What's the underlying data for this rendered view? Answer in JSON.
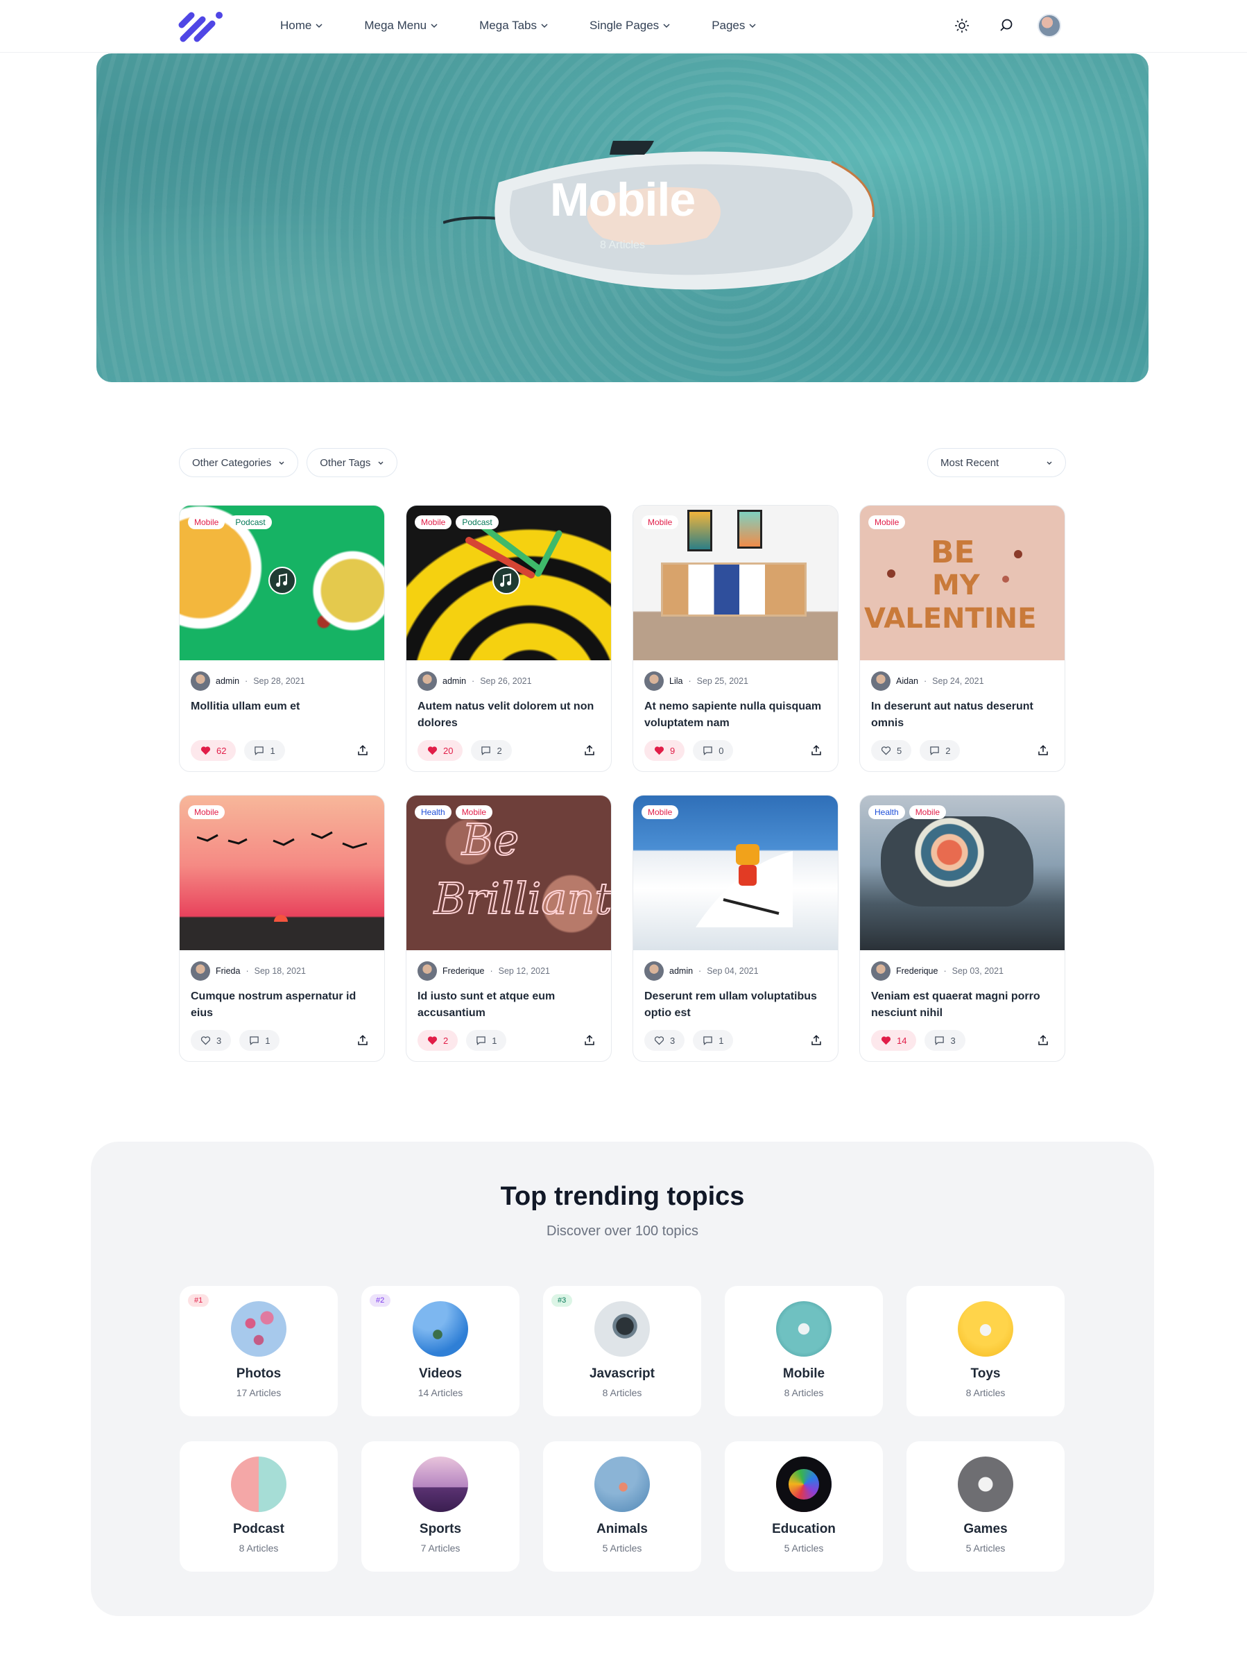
{
  "nav": {
    "items": [
      {
        "label": "Home"
      },
      {
        "label": "Mega Menu"
      },
      {
        "label": "Mega Tabs"
      },
      {
        "label": "Single Pages"
      },
      {
        "label": "Pages"
      }
    ],
    "icons": [
      "sun-icon",
      "search-icon",
      "avatar"
    ]
  },
  "hero": {
    "title": "Mobile",
    "subtitle": "8 Articles"
  },
  "filters": {
    "categories": "Other Categories",
    "tags": "Other Tags",
    "sort": "Most Recent"
  },
  "posts": [
    {
      "tags": [
        "Mobile",
        "Podcast"
      ],
      "author": "admin",
      "date": "Sep 28, 2021",
      "title": "Mollitia ullam eum et",
      "likes": "62",
      "liked": true,
      "comments": "1"
    },
    {
      "tags": [
        "Mobile",
        "Podcast"
      ],
      "author": "admin",
      "date": "Sep 26, 2021",
      "title": "Autem natus velit dolorem ut non dolores",
      "likes": "20",
      "liked": true,
      "comments": "2"
    },
    {
      "tags": [
        "Mobile"
      ],
      "author": "Lila",
      "date": "Sep 25, 2021",
      "title": "At nemo sapiente nulla quisquam voluptatem nam",
      "likes": "9",
      "liked": true,
      "comments": "0"
    },
    {
      "tags": [
        "Mobile"
      ],
      "author": "Aidan",
      "date": "Sep 24, 2021",
      "title": "In deserunt aut natus deserunt omnis",
      "likes": "5",
      "liked": false,
      "comments": "2"
    },
    {
      "tags": [
        "Mobile"
      ],
      "author": "Frieda",
      "date": "Sep 18, 2021",
      "title": "Cumque nostrum aspernatur id eius",
      "likes": "3",
      "liked": false,
      "comments": "1"
    },
    {
      "tags": [
        "Health",
        "Mobile"
      ],
      "author": "Frederique",
      "date": "Sep 12, 2021",
      "title": "Id iusto sunt et atque eum accusantium",
      "likes": "2",
      "liked": true,
      "comments": "1"
    },
    {
      "tags": [
        "Mobile"
      ],
      "author": "admin",
      "date": "Sep 04, 2021",
      "title": "Deserunt rem ullam voluptatibus optio est",
      "likes": "3",
      "liked": false,
      "comments": "1"
    },
    {
      "tags": [
        "Health",
        "Mobile"
      ],
      "author": "Frederique",
      "date": "Sep 03, 2021",
      "title": "Veniam est quaerat magni porro nesciunt nihil",
      "likes": "14",
      "liked": true,
      "comments": "3"
    }
  ],
  "trending": {
    "title": "Top trending topics",
    "subtitle": "Discover over 100 topics",
    "topics": [
      {
        "rank": "#1",
        "name": "Photos",
        "count": "17 Articles"
      },
      {
        "rank": "#2",
        "name": "Videos",
        "count": "14 Articles"
      },
      {
        "rank": "#3",
        "name": "Javascript",
        "count": "8 Articles"
      },
      {
        "rank": "",
        "name": "Mobile",
        "count": "8 Articles"
      },
      {
        "rank": "",
        "name": "Toys",
        "count": "8 Articles"
      },
      {
        "rank": "",
        "name": "Podcast",
        "count": "8 Articles"
      },
      {
        "rank": "",
        "name": "Sports",
        "count": "7 Articles"
      },
      {
        "rank": "",
        "name": "Animals",
        "count": "5 Articles"
      },
      {
        "rank": "",
        "name": "Education",
        "count": "5 Articles"
      },
      {
        "rank": "",
        "name": "Games",
        "count": "5 Articles"
      }
    ]
  },
  "colors": {
    "brand": "#4f46e5",
    "like": "#e11d48",
    "tag_red": "#e11d48",
    "tag_green": "#047857",
    "tag_blue": "#1d4ed8"
  }
}
